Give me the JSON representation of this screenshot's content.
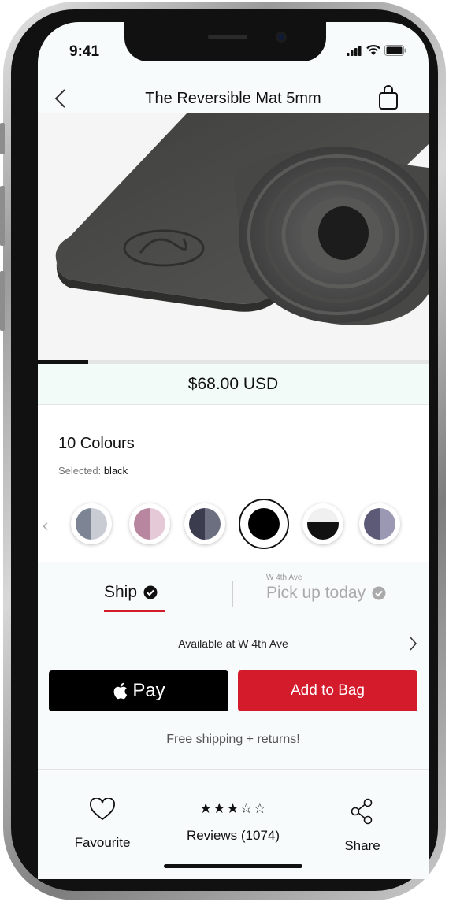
{
  "status_bar": {
    "time": "9:41"
  },
  "header": {
    "title": "The Reversible Mat 5mm"
  },
  "product": {
    "price": "$68.00 USD",
    "image_progress": 0.13,
    "mat_color": "#4a4a48"
  },
  "colours": {
    "count_label": "10 Colours",
    "selected_prefix": "Selected:",
    "selected_value": "black",
    "swatches": [
      {
        "name": "grey",
        "left": "#7d8595",
        "right": "#c9ccd3"
      },
      {
        "name": "pink",
        "left": "#b8869e",
        "right": "#e6c9d6"
      },
      {
        "name": "navy",
        "left": "#3b3d4e",
        "right": "#6c6f80"
      },
      {
        "name": "black",
        "left": "#000000",
        "right": "#000000"
      },
      {
        "name": "black-white",
        "left": "#111111",
        "right": "#f0f0f0"
      },
      {
        "name": "purple",
        "left": "#5d5a78",
        "right": "#9b98b4"
      }
    ]
  },
  "fulfilment": {
    "ship_label": "Ship",
    "pickup_sub": "W 4th Ave",
    "pickup_label": "Pick up today",
    "availability": "Available at W 4th Ave"
  },
  "actions": {
    "apple_pay_label": "Pay",
    "add_to_bag_label": "Add to Bag",
    "free_shipping": "Free shipping + returns!"
  },
  "bottom_bar": {
    "favourite_label": "Favourite",
    "reviews_label": "Reviews (1074)",
    "rating": 3,
    "rating_max": 5,
    "share_label": "Share"
  },
  "colors": {
    "accent": "#d31b2c",
    "primary_text": "#111111"
  }
}
